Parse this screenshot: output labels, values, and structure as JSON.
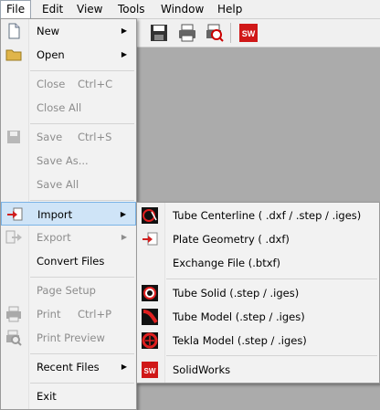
{
  "menubar": [
    "File",
    "Edit",
    "View",
    "Tools",
    "Window",
    "Help"
  ],
  "file_menu": {
    "new": "New",
    "open": "Open",
    "close": "Close",
    "close_sc": "Ctrl+C",
    "close_all": "Close All",
    "save": "Save",
    "save_sc": "Ctrl+S",
    "save_as": "Save As...",
    "save_all": "Save All",
    "import": "Import",
    "export": "Export",
    "convert": "Convert Files",
    "page_setup": "Page Setup",
    "print": "Print",
    "print_sc": "Ctrl+P",
    "print_preview": "Print Preview",
    "recent": "Recent Files",
    "exit": "Exit"
  },
  "import_menu": {
    "tube_centerline": "Tube Centerline ( .dxf / .step / .iges)",
    "plate_geometry": "Plate Geometry ( .dxf)",
    "exchange_file": "Exchange File (.btxf)",
    "tube_solid": "Tube Solid (.step / .iges)",
    "tube_model": "Tube Model (.step / .iges)",
    "tekla_model": "Tekla Model (.step / .iges)",
    "solidworks": "SolidWorks"
  },
  "colors": {
    "highlight": "#cfe4f7",
    "highlight_border": "#7ab3e6",
    "disabled": "#8d8d8d"
  }
}
